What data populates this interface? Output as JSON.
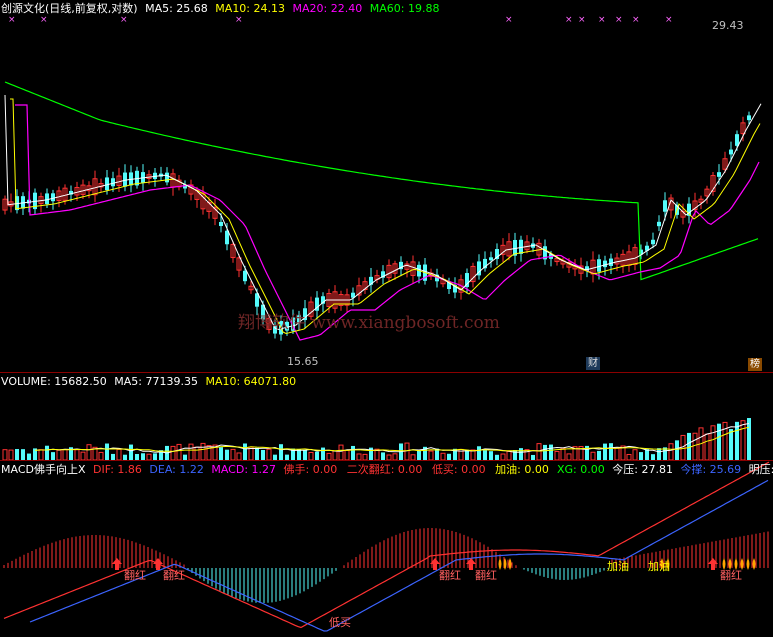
{
  "colors": {
    "up": "#ff3232",
    "down": "#54fcfc",
    "ma5": "#ffffff",
    "ma10": "#ffff00",
    "ma20": "#ff00ff",
    "ma60": "#00ff00",
    "divider": "#8b0000",
    "dif": "#ff3232",
    "dea": "#3c64ff",
    "macd_pos": "#ff3232",
    "macd_neg": "#54fcfc"
  },
  "price_panel": {
    "title": "创源文化(日线,前复权,对数)",
    "ma5": "MA5: 25.68",
    "ma10": "MA10: 24.13",
    "ma20": "MA20: 22.40",
    "ma60": "MA60: 19.88",
    "high_label": "29.43",
    "low_label": "15.65",
    "watermark": "翔博软件 www.xiangbosoft.com",
    "badge_cai": "财",
    "badge_bang": "榜"
  },
  "volume_panel": {
    "volume": "VOLUME: 15682.50",
    "ma5": "MA5: 77139.35",
    "ma10": "MA10: 64071.80"
  },
  "macd_panel": {
    "name": "MACD佛手向上X",
    "dif": "DIF: 1.86",
    "dea": "DEA: 1.22",
    "macd": "MACD: 1.27",
    "foshou": "佛手: 0.00",
    "erci": "二次翻红: 0.00",
    "dimai": "低买: 0.00",
    "jiayou": "加油: 0.00",
    "xg": "XG: 0.00",
    "jinya": "今压: 27.81",
    "jinzhi": "今撑: 25.69",
    "mingya": "明压:",
    "sig_fanhong": "翻红",
    "sig_dimai": "低买",
    "sig_jiayou": "加油"
  },
  "icons": {
    "arrow": "up-arrow-icon",
    "flame": "flame-icon"
  }
}
